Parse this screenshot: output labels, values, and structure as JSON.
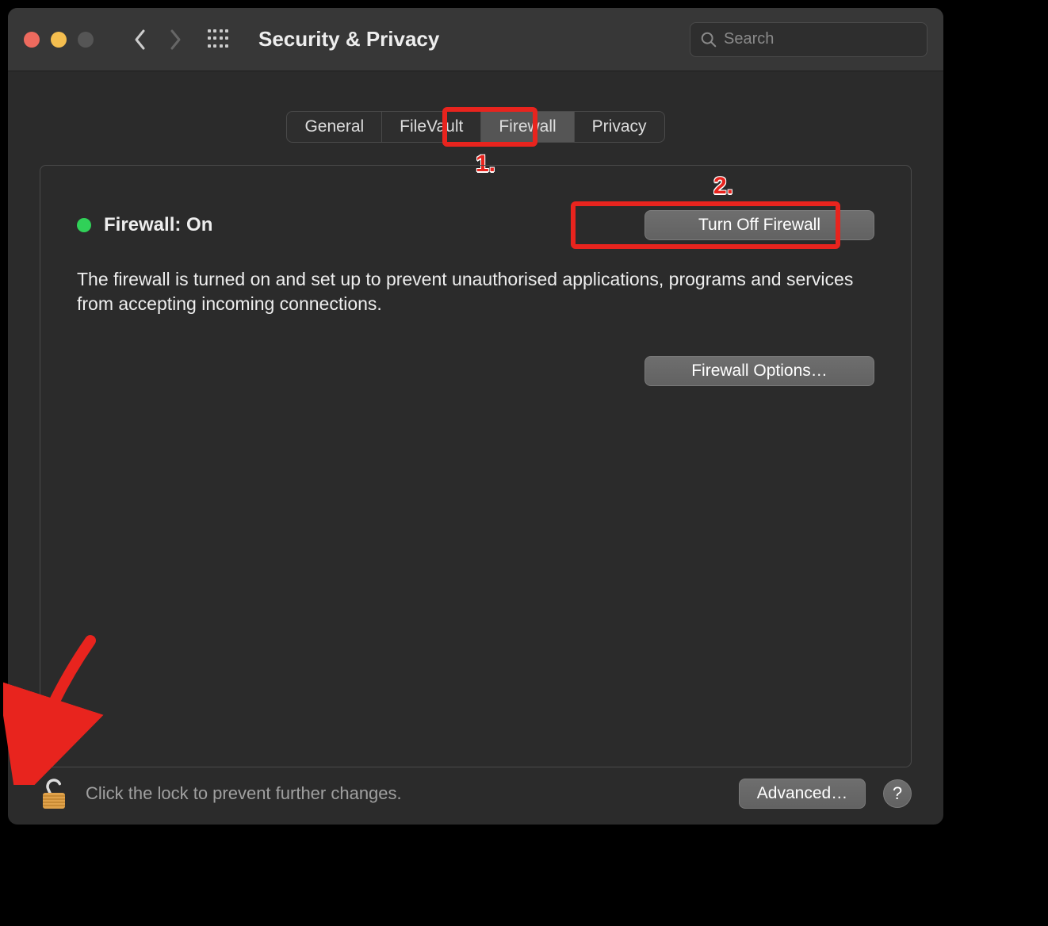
{
  "window": {
    "title": "Security & Privacy",
    "search_placeholder": "Search"
  },
  "tabs": {
    "items": [
      "General",
      "FileVault",
      "Firewall",
      "Privacy"
    ],
    "selected_index": 2
  },
  "firewall": {
    "status_label": "Firewall: On",
    "status_color": "#30d158",
    "turn_off_label": "Turn Off Firewall",
    "description": "The firewall is turned on and set up to prevent unauthorised applications, programs and services from accepting incoming connections.",
    "options_label": "Firewall Options…"
  },
  "footer": {
    "lock_label": "Click the lock to prevent further changes.",
    "advanced_label": "Advanced…",
    "help_label": "?"
  },
  "annotations": {
    "step1": "1.",
    "step2": "2."
  }
}
